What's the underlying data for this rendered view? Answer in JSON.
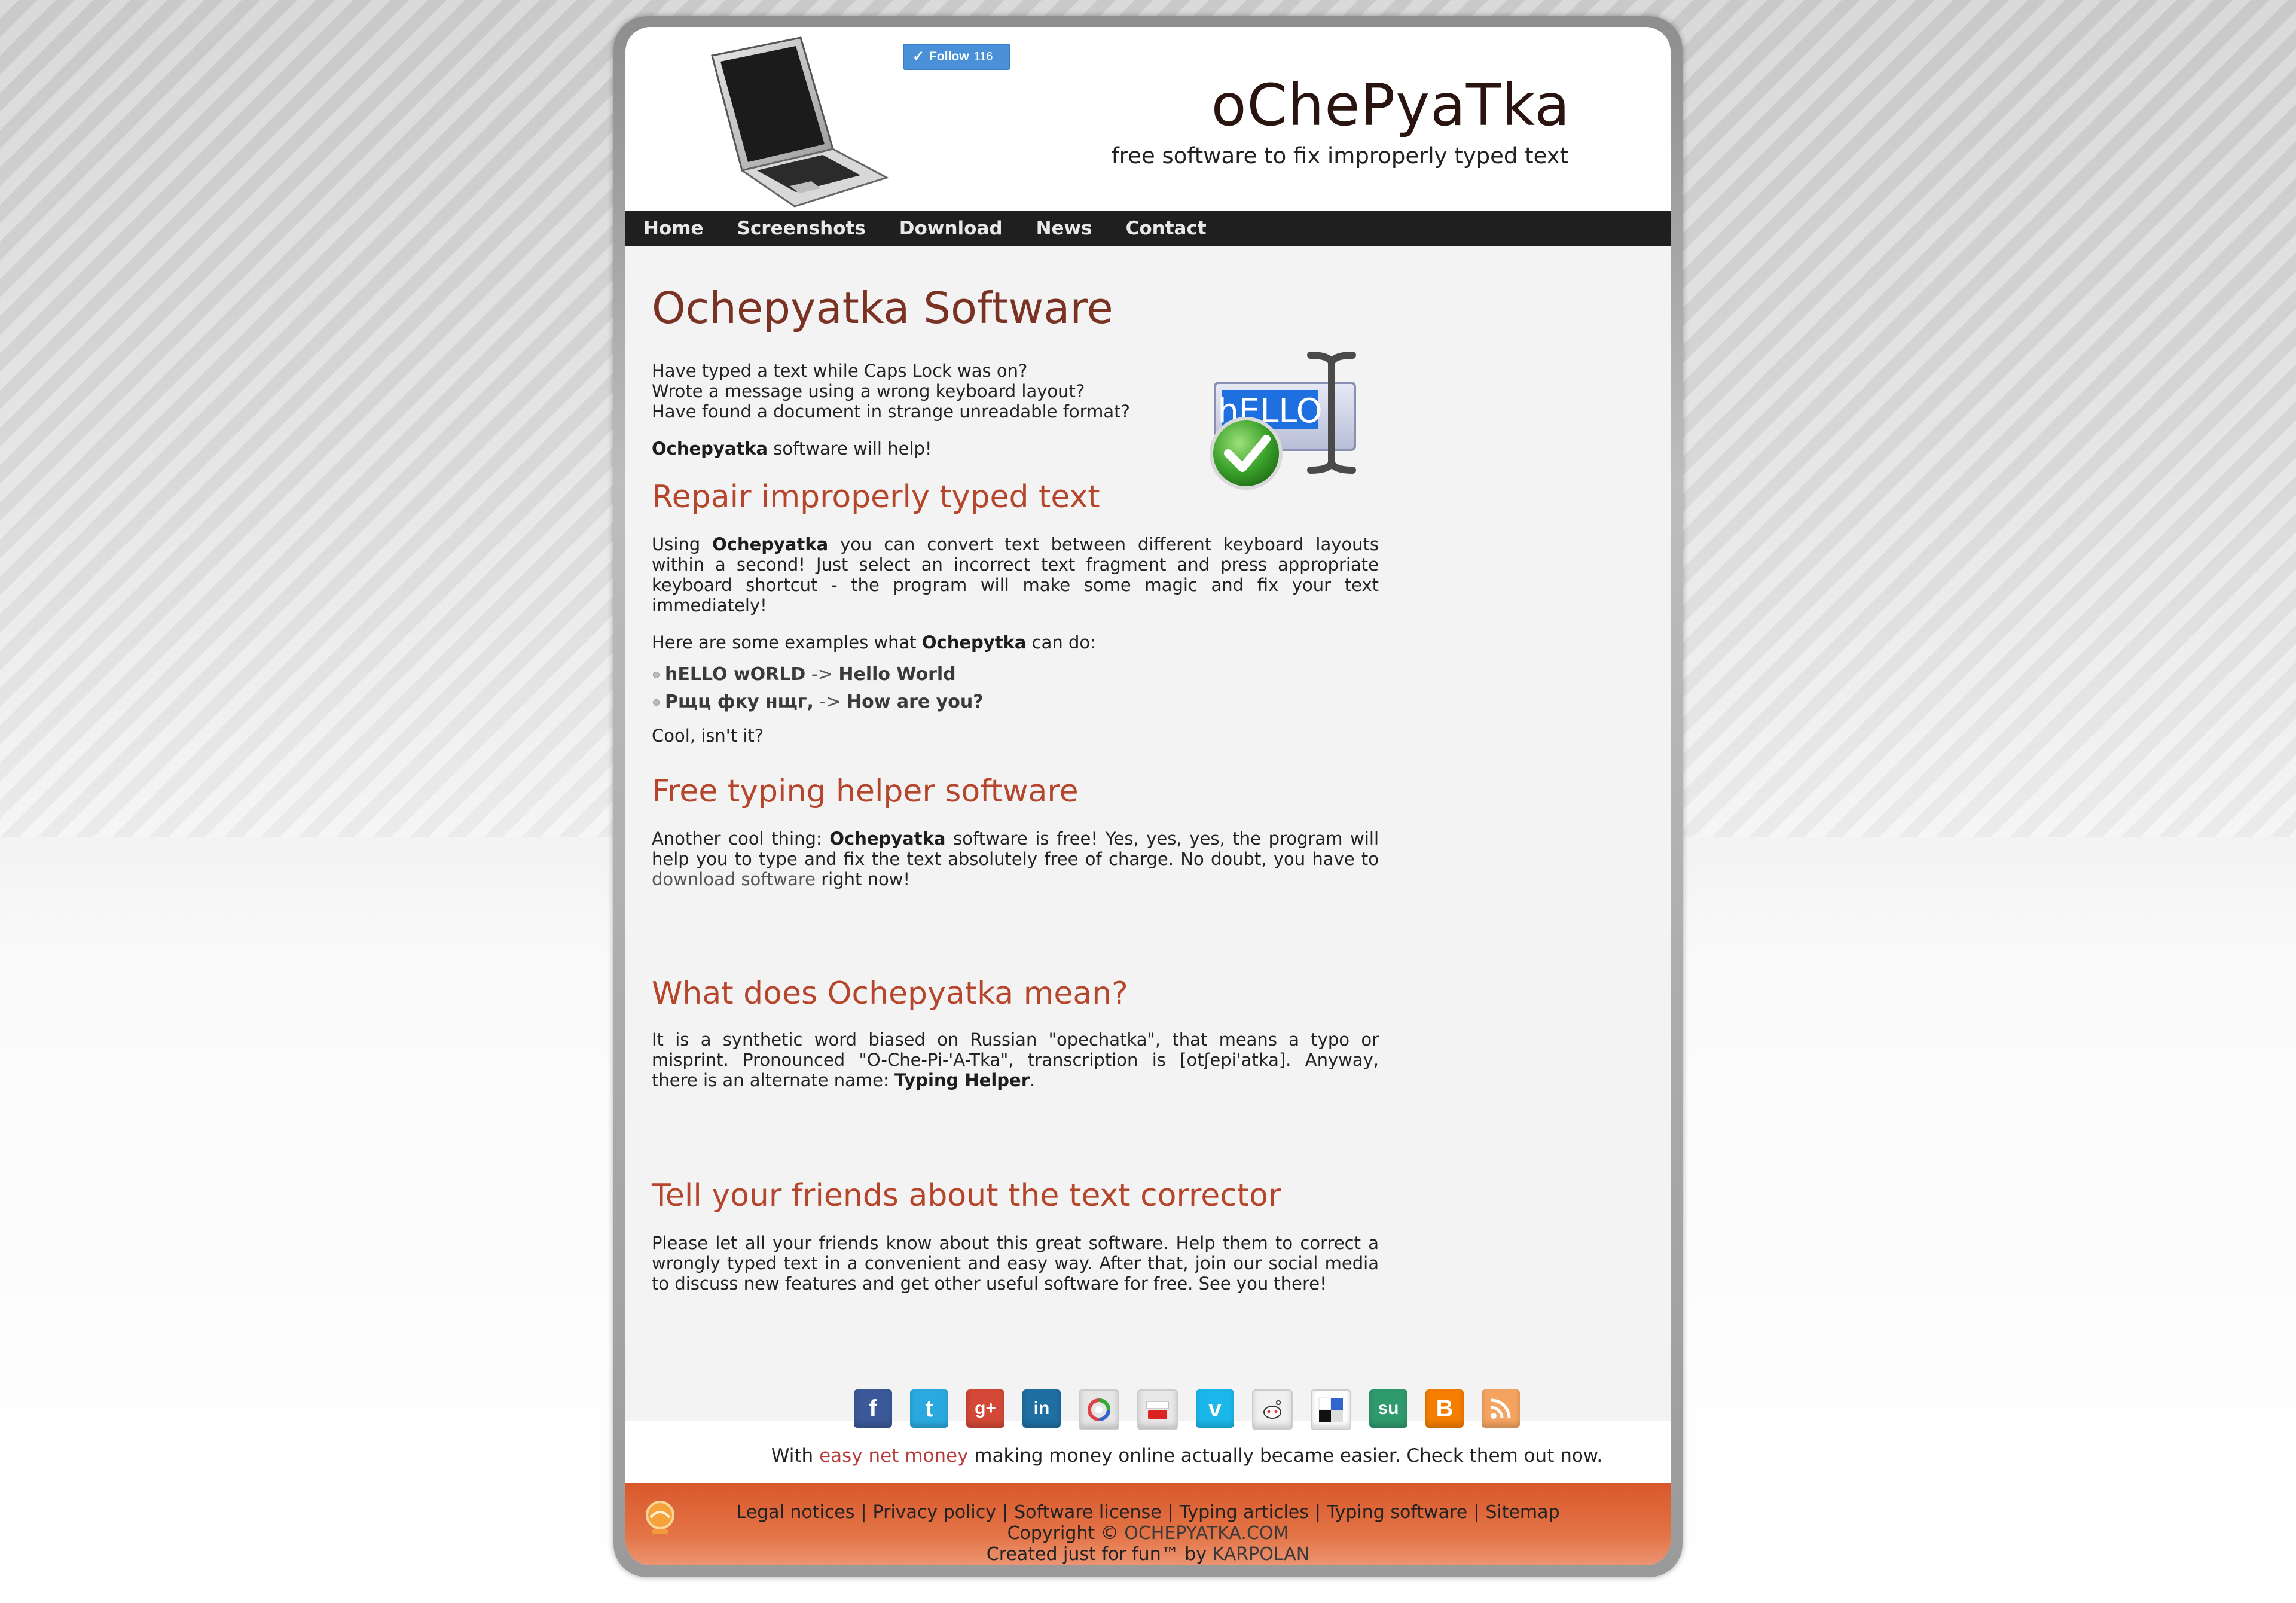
{
  "header": {
    "title": "oChePyaTka",
    "tagline": "free software to fix improperly typed text",
    "follow_label": "Follow",
    "follow_count": "116"
  },
  "nav": {
    "items": [
      "Home",
      "Screenshots",
      "Download",
      "News",
      "Contact"
    ]
  },
  "main": {
    "heading": "Ochepyatka Software",
    "intro": {
      "line1": "Have typed a text while Caps Lock was on?",
      "line2": "Wrote a message using a wrong keyboard layout?",
      "line3": "Have found a document in strange unreadable format?"
    },
    "help": {
      "bold": "Ochepyatka",
      "rest": " software will help!"
    },
    "hero_image_text": "hELLO",
    "section1": {
      "heading": "Repair improperly typed text",
      "p1_a": "Using ",
      "p1_b": "Ochepyatka",
      "p1_c": " you can convert text between different keyboard layouts within a second! Just select an incorrect text fragment and press appropriate keyboard shortcut - the program will make some magic and fix your text immediately!",
      "p2_a": "Here are some examples what ",
      "p2_b": "Ochepytka",
      "p2_c": " can do:",
      "examples": [
        {
          "from": "hELLO wORLD",
          "arrow": " -> ",
          "to": "Hello World"
        },
        {
          "from": "Рщц фку нщг,",
          "arrow": " -> ",
          "to": "How are you?"
        }
      ],
      "p3": "Cool, isn't it?"
    },
    "section2": {
      "heading": "Free typing helper software",
      "p_a": "Another cool thing: ",
      "p_b": "Ochepyatka",
      "p_c": " software is free! Yes, yes, yes, the program will help you to type and fix the text absolutely free of charge. No doubt, you have to ",
      "p_link": "download software",
      "p_d": " right now!"
    },
    "section3": {
      "heading": "What does Ochepyatka mean?",
      "p_a": "It is a synthetic word biased on Russian \"opechatka\", that means a typo or misprint. Pronounced \"O-Che-Pi-'A-Tka\", transcription is [otʃepi'atka]. Anyway, there is an alternate name: ",
      "p_b": "Typing Helper",
      "p_c": "."
    },
    "section4": {
      "heading": "Tell your friends about the text corrector",
      "p": "Please let all your friends know about this great software. Help them to correct a wrongly typed text in a convenient and easy way. After that, join our social media to discuss new features and get other useful software for free. See you there!"
    }
  },
  "social": {
    "icons": [
      {
        "name": "facebook-icon",
        "glyph": "f",
        "color": "#3b5998"
      },
      {
        "name": "twitter-icon",
        "glyph": "t",
        "color": "#2aa9e0"
      },
      {
        "name": "google-plus-icon",
        "glyph": "g+",
        "color": "#d34836"
      },
      {
        "name": "linkedin-icon",
        "glyph": "in",
        "color": "#1f6fa3"
      },
      {
        "name": "picasa-icon",
        "glyph": "",
        "color": "#e6e6e6"
      },
      {
        "name": "youtube-icon",
        "glyph": "",
        "color": "#e8e8e8"
      },
      {
        "name": "vimeo-icon",
        "glyph": "v",
        "color": "#1ab7ea"
      },
      {
        "name": "reddit-icon",
        "glyph": "",
        "color": "#f0f0f0"
      },
      {
        "name": "delicious-icon",
        "glyph": "",
        "color": "#ffffff"
      },
      {
        "name": "stumbleupon-icon",
        "glyph": "su",
        "color": "#2f9a6c"
      },
      {
        "name": "blogger-icon",
        "glyph": "B",
        "color": "#f57d00"
      },
      {
        "name": "rss-icon",
        "glyph": "",
        "color": "#f4a460"
      }
    ]
  },
  "promo": {
    "a": "With ",
    "link": "easy net money",
    "b": " making money online actually became easier. Check them out now."
  },
  "footer": {
    "links": [
      "Legal notices",
      "Privacy policy",
      "Software license",
      "Typing articles",
      "Typing software",
      "Sitemap"
    ],
    "copyright_a": "Copyright © ",
    "copyright_link": "OCHEPYATKA.COM",
    "created_a": "Created just for fun™ by ",
    "created_link": "KARPOLAN"
  }
}
